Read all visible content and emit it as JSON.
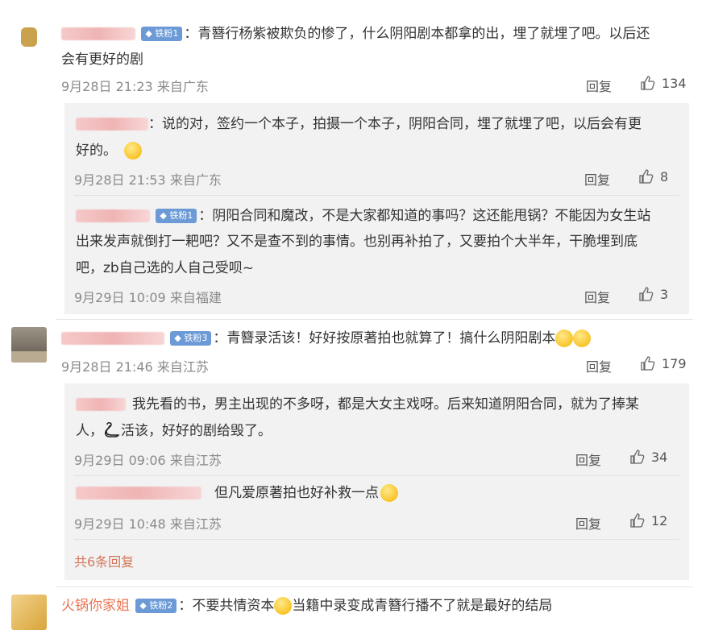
{
  "comments": [
    {
      "badge": "铁粉1",
      "line1": "：青簪行杨紫被欺负的惨了，什么阴阳剧本都拿的出，埋了就埋了吧。以后还",
      "line2": "会有更好的剧",
      "time": "9月28日 21:23 来自广东",
      "reply": "回复",
      "likes": "134",
      "replies": [
        {
          "line1": "：说的对，签约一个本子，拍摄一个本子，阴阳合同，埋了就埋了吧，以后会有更",
          "line2": "好的。",
          "time": "9月28日 21:53 来自广东",
          "reply": "回复",
          "likes": "8"
        },
        {
          "badge": "铁粉1",
          "line1": "：阴阳合同和魔改，不是大家都知道的事吗？这还能甩锅？不能因为女生站",
          "line2": "出来发声就倒打一耙吧？又不是查不到的事情。也别再补拍了，又要拍个大半年，干脆埋到底",
          "line3": "吧，zb自己选的人自己受呗~",
          "time": "9月29日 10:09 来自福建",
          "reply": "回复",
          "likes": "3"
        }
      ]
    },
    {
      "badge": "铁粉3",
      "line1": "：青簪录活该！好好按原著拍也就算了！搞什么阴阳剧本",
      "time": "9月28日 21:46 来自江苏",
      "reply": "回复",
      "likes": "179",
      "replies": [
        {
          "line1": "我先看的书，男主出现的不多呀，都是大女主戏呀。后来知道阴阳合同，就为了捧某",
          "line2a": "人，",
          "line2b": "活该，好好的剧给毁了。",
          "time": "9月29日 09:06 来自江苏",
          "reply": "回复",
          "likes": "34"
        },
        {
          "line1": "但凡爱原著拍也好补救一点",
          "time": "9月29日 10:48 来自江苏",
          "reply": "回复",
          "likes": "12"
        }
      ],
      "more": "共6条回复"
    },
    {
      "name": "火锅你家姐",
      "badge": "铁粉2",
      "line1a": "：不要共情资本",
      "line1b": "当籍中录变成青簪行播不了就是最好的结局"
    }
  ]
}
